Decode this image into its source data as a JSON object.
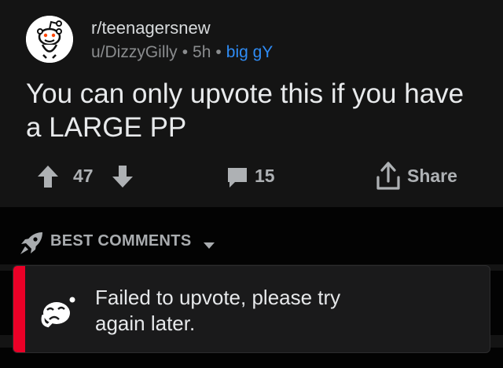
{
  "post": {
    "subreddit": "r/teenagersnew",
    "author": "u/DizzyGilly",
    "age": "5h",
    "separator": "•",
    "flair": "big gY",
    "title": "You can only upvote this if you have a LARGE PP",
    "vote_count": "47",
    "comment_count": "15",
    "share_label": "Share"
  },
  "comments": {
    "sort_label": "BEST COMMENTS"
  },
  "toast": {
    "message": "Failed to upvote, please try again later."
  },
  "colors": {
    "accent_blue": "#2f8cf5",
    "error_red": "#ea0027",
    "post_bg": "#141414",
    "page_bg": "#030303"
  },
  "icons": [
    "snoo-avatar-icon",
    "upvote-arrow-icon",
    "downvote-arrow-icon",
    "comment-icon",
    "share-icon",
    "rocket-icon",
    "chevron-down-icon",
    "sad-snoo-icon"
  ]
}
